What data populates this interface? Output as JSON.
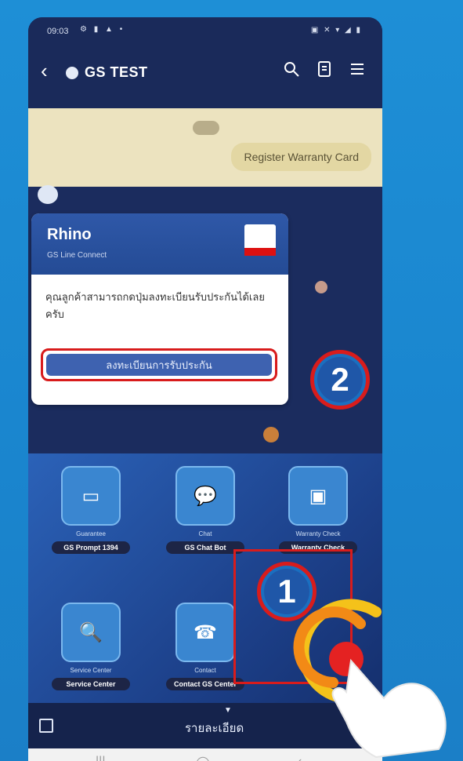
{
  "status_bar": {
    "time": "09:03",
    "left_icons": "⚙ ▮ ▲ •",
    "right_icons": "▣ ✕ ▾ ◢ ▮"
  },
  "header": {
    "title": "GS TEST",
    "back_glyph": "‹"
  },
  "chat": {
    "user_message": "Register Warranty Card",
    "card": {
      "brand": "Rhino",
      "subtitle": "GS Line Connect",
      "message": "คุณลูกค้าสามารถกดปุ่มลงทะเบียนรับประกันได้เลยครับ",
      "button_label": "ลงทะเบียนการรับประกัน"
    }
  },
  "steps": {
    "step1": "1",
    "step2": "2"
  },
  "menu": {
    "tiles": [
      {
        "caption": "Guarantee",
        "pill": "GS Prompt 1394"
      },
      {
        "caption": "Chat",
        "pill": "GS Chat Bot"
      },
      {
        "caption": "Warranty Check",
        "pill": "Warranty Check"
      },
      {
        "caption": "Service Center",
        "pill": "Service Center"
      },
      {
        "caption": "Contact",
        "pill": "Contact GS Center"
      },
      {
        "caption": "",
        "pill": ""
      }
    ]
  },
  "rich_menu_bar": {
    "label": "รายละเอียด"
  },
  "system_nav": {
    "recent": "|||",
    "home": "◯",
    "back": "‹"
  }
}
